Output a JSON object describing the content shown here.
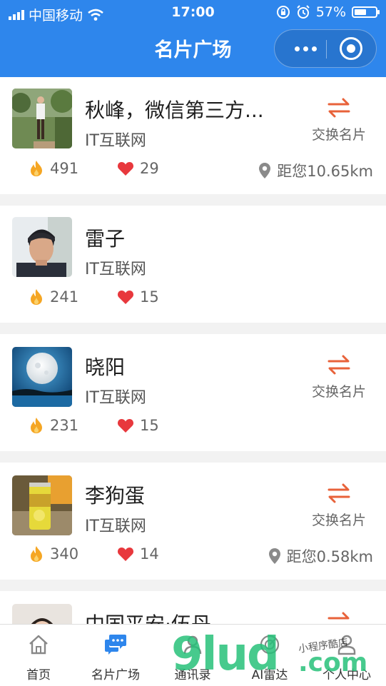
{
  "status_bar": {
    "carrier": "中国移动",
    "time": "17:00",
    "battery": "57%",
    "battery_level": 0.57
  },
  "navbar": {
    "title": "名片广场"
  },
  "colors": {
    "primary": "#2e86ec",
    "exchange": "#e8623a",
    "fire": "#f5a623",
    "heart": "#e8383d"
  },
  "cards": [
    {
      "name": "秋峰，微信第三方...",
      "industry": "IT互联网",
      "popularity": "491",
      "likes": "29",
      "exchange_label": "交换名片",
      "distance": "距您10.65km"
    },
    {
      "name": "雷子",
      "industry": "IT互联网",
      "popularity": "241",
      "likes": "15"
    },
    {
      "name": "晓阳",
      "industry": "IT互联网",
      "popularity": "231",
      "likes": "15",
      "exchange_label": "交换名片"
    },
    {
      "name": "李狗蛋",
      "industry": "IT互联网",
      "popularity": "340",
      "likes": "14",
      "exchange_label": "交换名片",
      "distance": "距您0.58km"
    },
    {
      "name": "中国平安·伍丹"
    }
  ],
  "tabbar": {
    "items": [
      {
        "label": "首页",
        "icon": "home-icon"
      },
      {
        "label": "名片广场",
        "icon": "chat-bubble-icon"
      },
      {
        "label": "通讯录",
        "icon": "contacts-icon"
      },
      {
        "label": "AI雷达",
        "icon": "radar-icon"
      },
      {
        "label": "个人中心",
        "icon": "person-icon"
      }
    ]
  },
  "watermark": {
    "text": "9lud",
    "suffix": ".com",
    "tagline": "小程序酷店"
  }
}
